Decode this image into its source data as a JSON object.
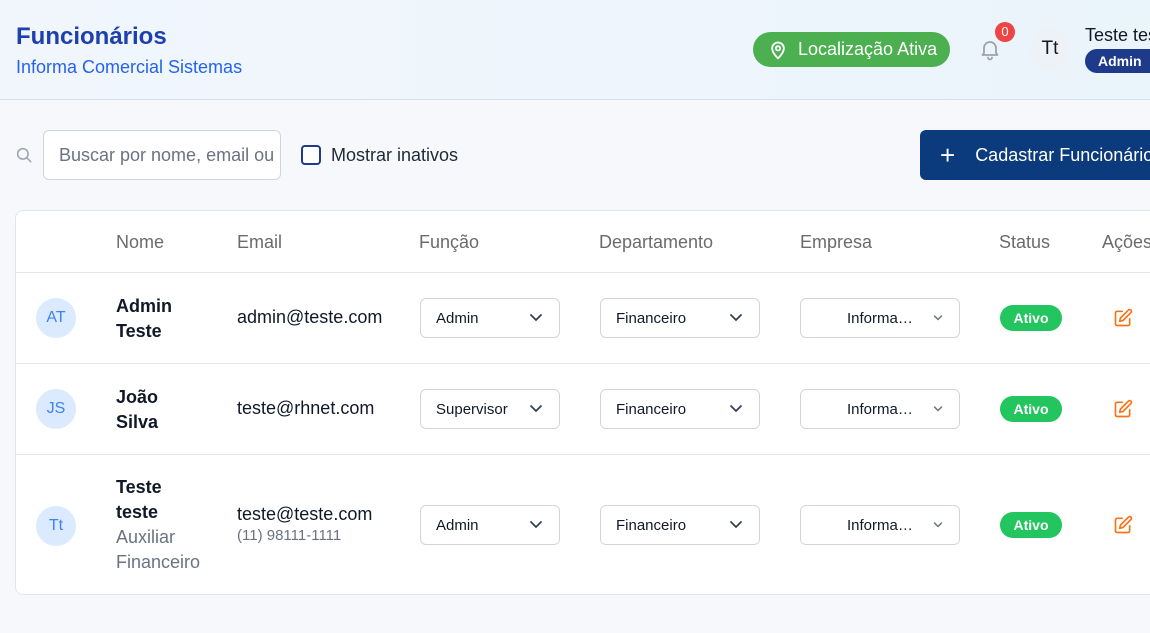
{
  "header": {
    "title": "Funcionários",
    "subtitle": "Informa Comercial Sistemas",
    "location_badge": "Localização Ativa",
    "notification_count": "0",
    "user_initials": "Tt",
    "user_name": "Teste teste",
    "user_role": "Admin"
  },
  "toolbar": {
    "search_placeholder": "Buscar por nome, email ou",
    "show_inactive_label": "Mostrar inativos",
    "show_inactive_checked": false,
    "add_button_label": "Cadastrar Funcionário"
  },
  "table": {
    "columns": [
      "Nome",
      "Email",
      "Função",
      "Departamento",
      "Empresa",
      "Status",
      "Ações"
    ],
    "rows": [
      {
        "initials": "AT",
        "name_line1": "Admin",
        "name_line2": "Teste",
        "job_line1": "",
        "job_line2": "",
        "email": "admin@teste.com",
        "phone": "",
        "role": "Admin",
        "department": "Financeiro",
        "company": "Informa…",
        "status": "Ativo"
      },
      {
        "initials": "JS",
        "name_line1": "João",
        "name_line2": "Silva",
        "job_line1": "",
        "job_line2": "",
        "email": "teste@rhnet.com",
        "phone": "",
        "role": "Supervisor",
        "department": "Financeiro",
        "company": "Informa…",
        "status": "Ativo"
      },
      {
        "initials": "Tt",
        "name_line1": "Teste",
        "name_line2": "teste",
        "job_line1": "Auxiliar",
        "job_line2": "Financeiro",
        "email": "teste@teste.com",
        "phone": "(11) 98111-1111",
        "role": "Admin",
        "department": "Financeiro",
        "company": "Informa…",
        "status": "Ativo"
      }
    ]
  },
  "colors": {
    "title": "#1e40af",
    "primary_button": "#0b3b7d",
    "location_badge": "#4caf50",
    "status_active": "#22c55e",
    "edit_icon": "#f97316",
    "notification_badge": "#ef4444"
  },
  "icons": {
    "location": "map-pin-icon",
    "notifications": "bell-icon",
    "search": "search-icon",
    "add": "plus-icon",
    "select": "chevron-down-icon",
    "edit": "edit-icon"
  }
}
